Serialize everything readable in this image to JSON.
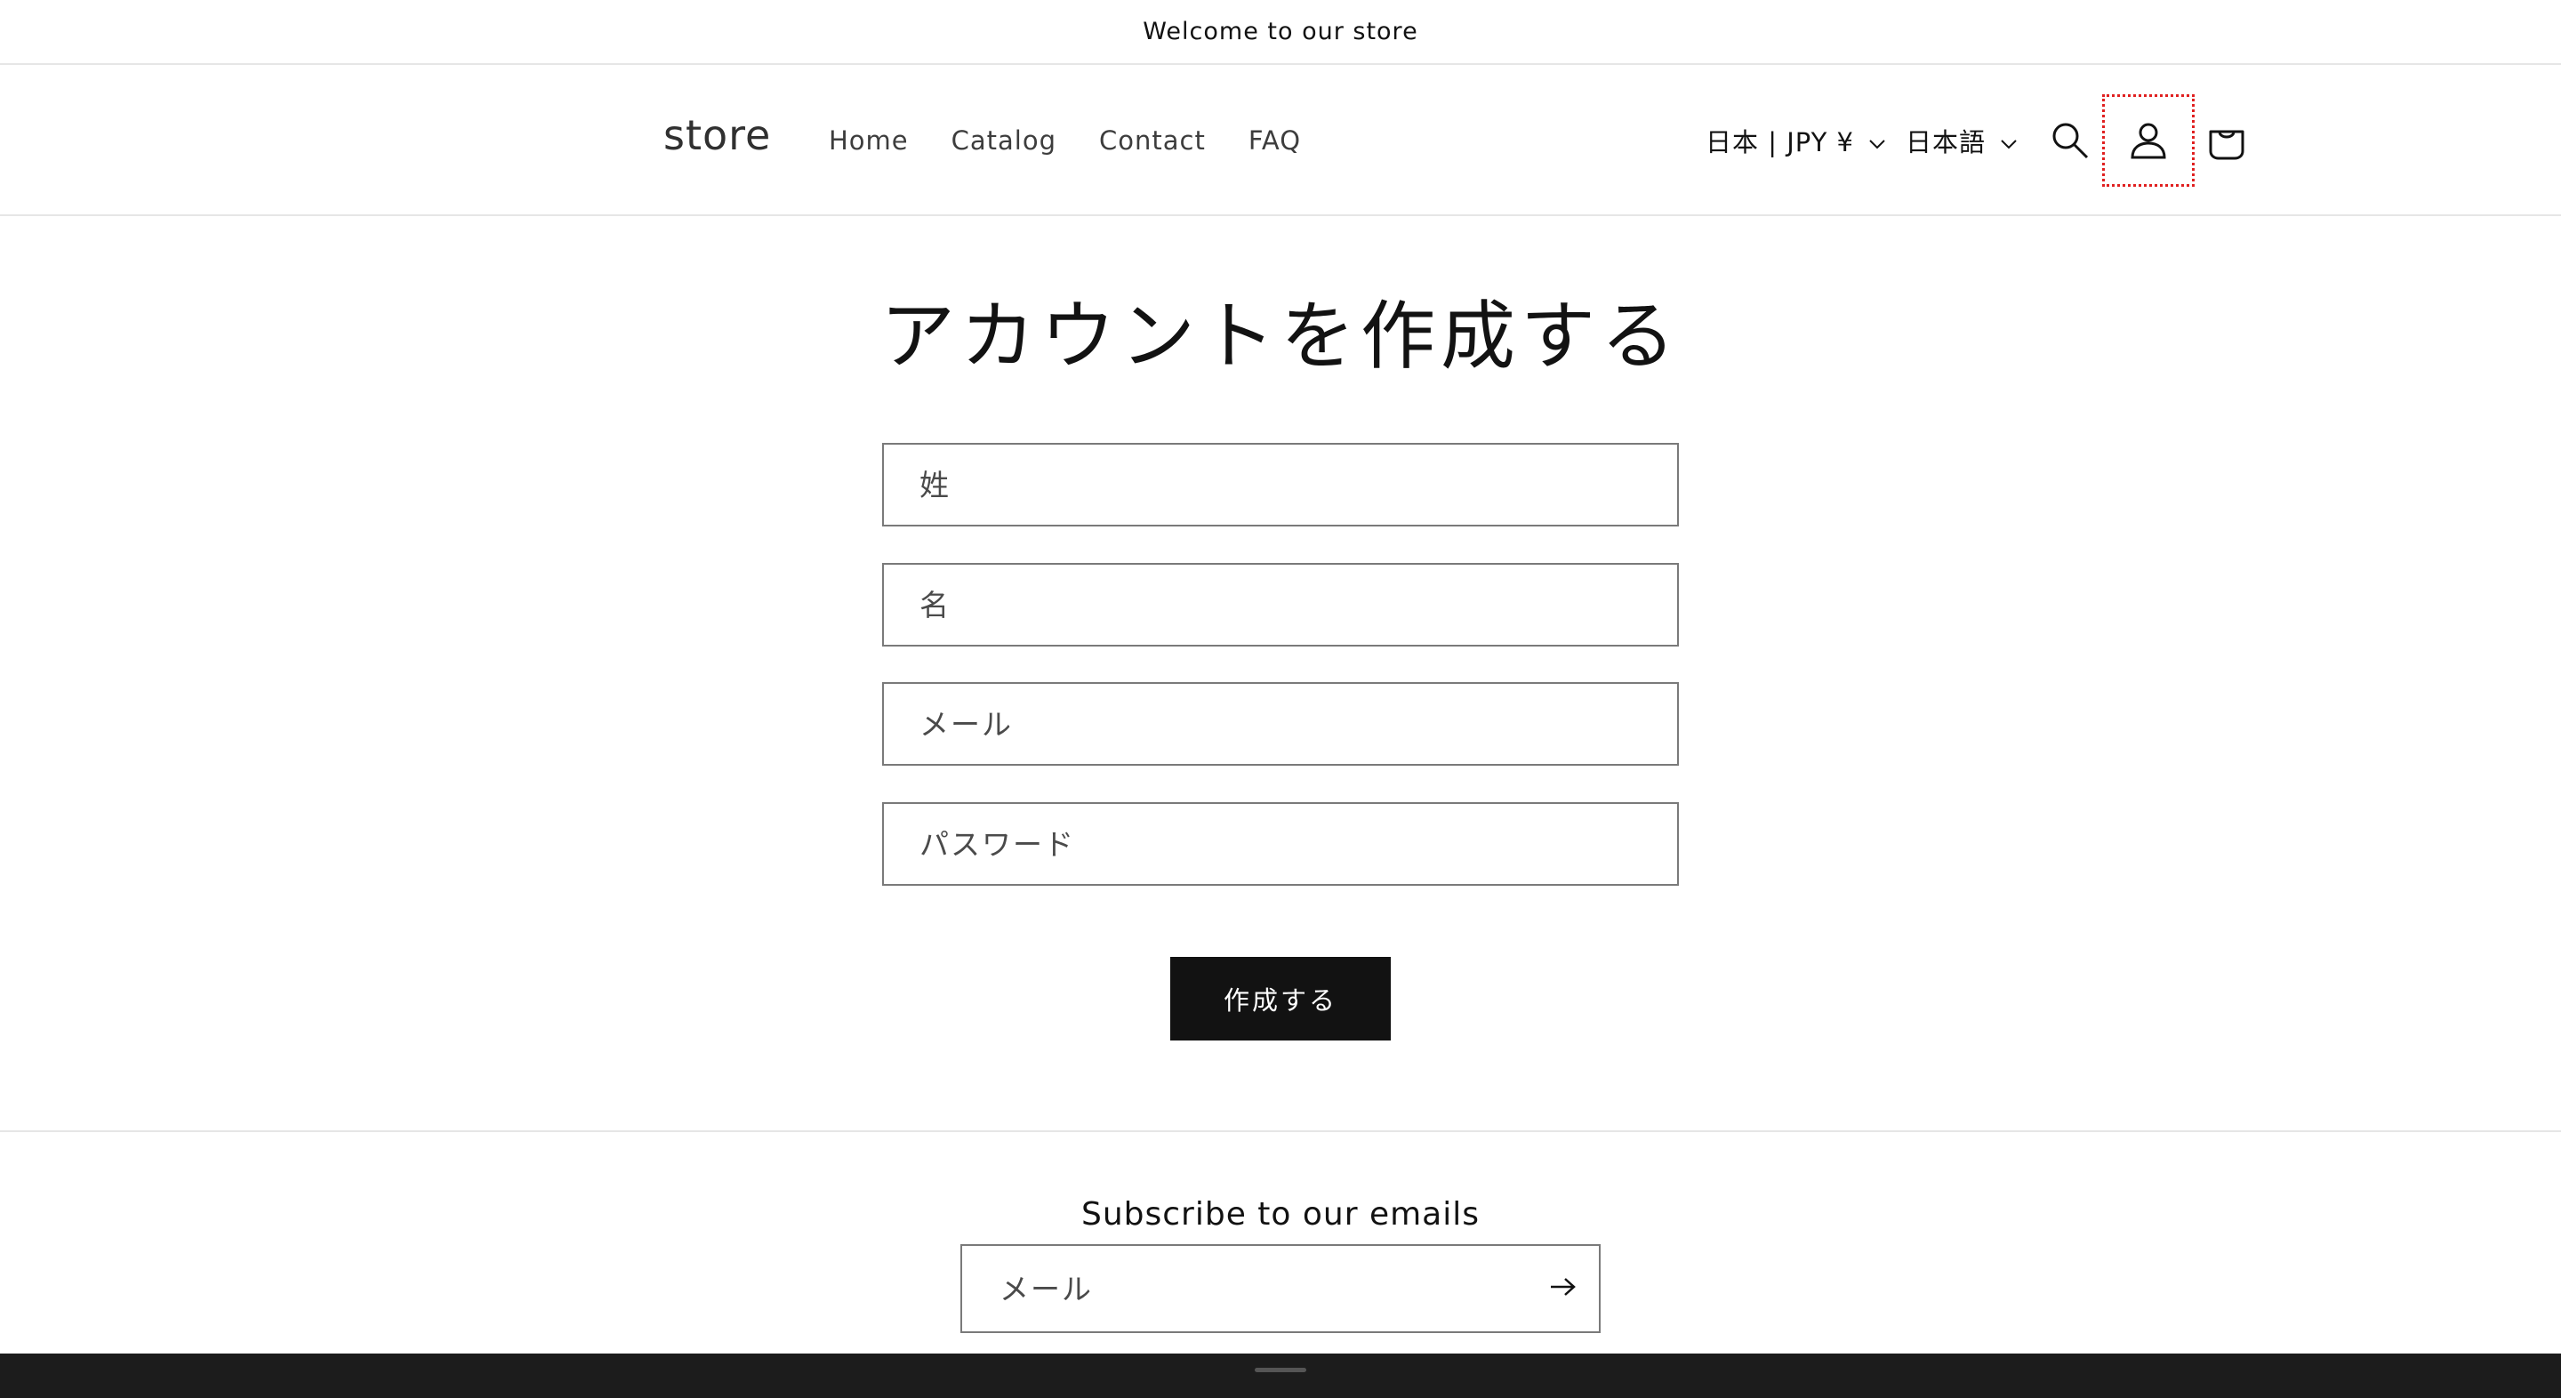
{
  "announcement": {
    "text": "Welcome to our store"
  },
  "header": {
    "logo": "store",
    "nav": [
      "Home",
      "Catalog",
      "Contact",
      "FAQ"
    ],
    "country_selector": "日本 | JPY ¥",
    "language_selector": "日本語",
    "icons": [
      "search-icon",
      "account-icon",
      "cart-icon"
    ]
  },
  "main": {
    "title": "アカウントを作成する",
    "fields": {
      "last_name_placeholder": "姓",
      "first_name_placeholder": "名",
      "email_placeholder": "メール",
      "password_placeholder": "パスワード"
    },
    "submit_label": "作成する"
  },
  "footer": {
    "subscribe_title": "Subscribe to our emails",
    "email_placeholder": "メール"
  },
  "colors": {
    "text": "#121212",
    "button_bg": "#121212",
    "border": "#7a7a7a",
    "focus_outline": "#e02020"
  }
}
